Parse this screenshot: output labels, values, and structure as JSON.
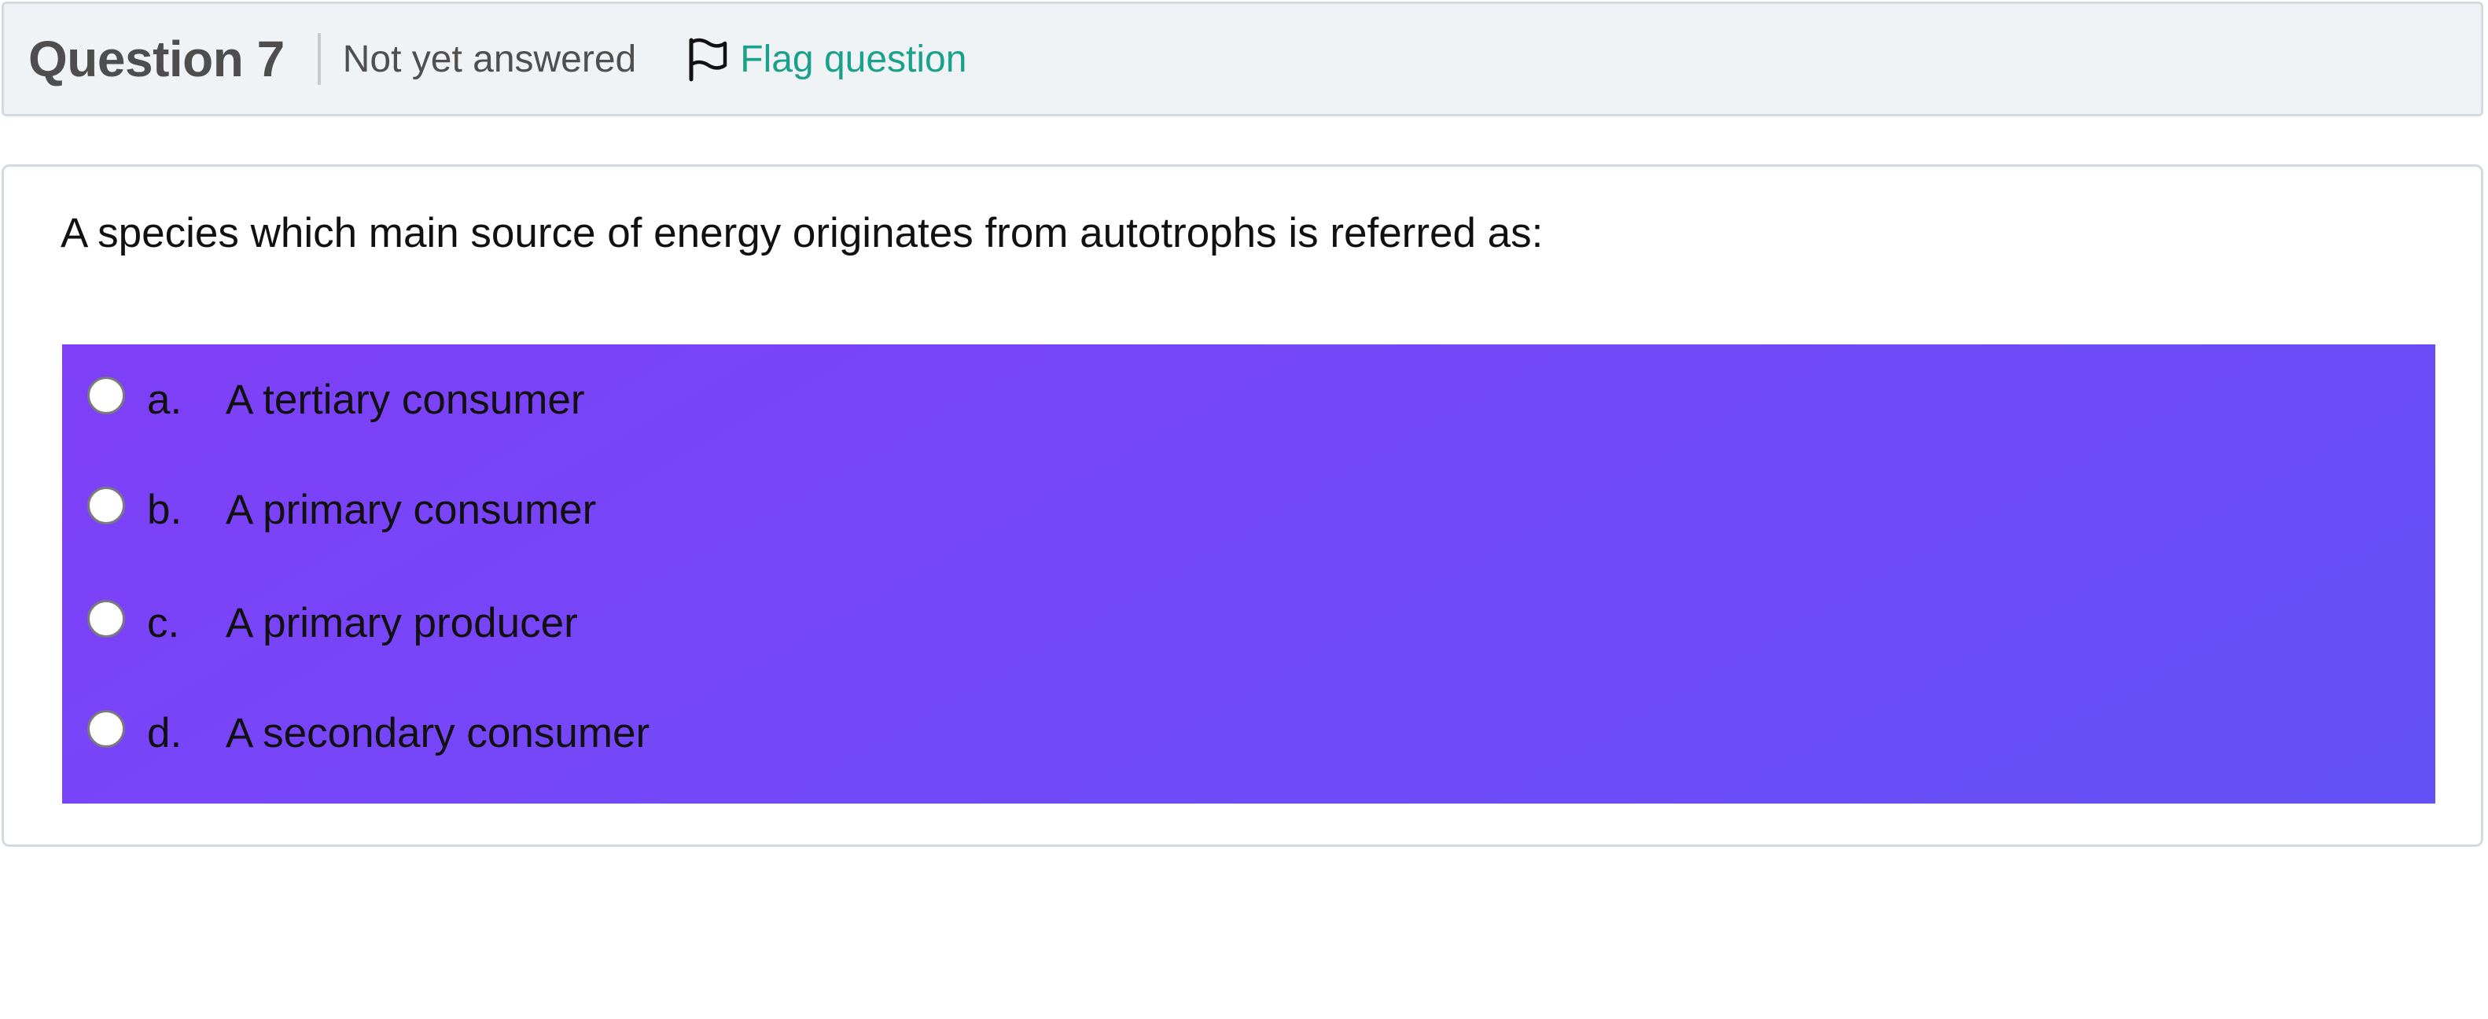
{
  "header": {
    "question_title": "Question 7",
    "state": "Not yet answered",
    "flag_label": "Flag question",
    "flag_icon": "flag-icon"
  },
  "question": {
    "text": "A species which main source of energy originates from autotrophs is referred as:"
  },
  "answers": [
    {
      "letter": "a.",
      "text": "A tertiary consumer",
      "selected": false
    },
    {
      "letter": "b.",
      "text": "A primary consumer",
      "selected": false
    },
    {
      "letter": "c.",
      "text": "A primary producer",
      "selected": false
    },
    {
      "letter": "d.",
      "text": "A secondary consumer",
      "selected": false
    }
  ],
  "colors": {
    "header_bg": "#f0f3f6",
    "border": "#d4dae3",
    "flag_link": "#1aa18c",
    "answers_gradient_start": "#7f3ff7",
    "answers_gradient_end": "#6451f6"
  }
}
